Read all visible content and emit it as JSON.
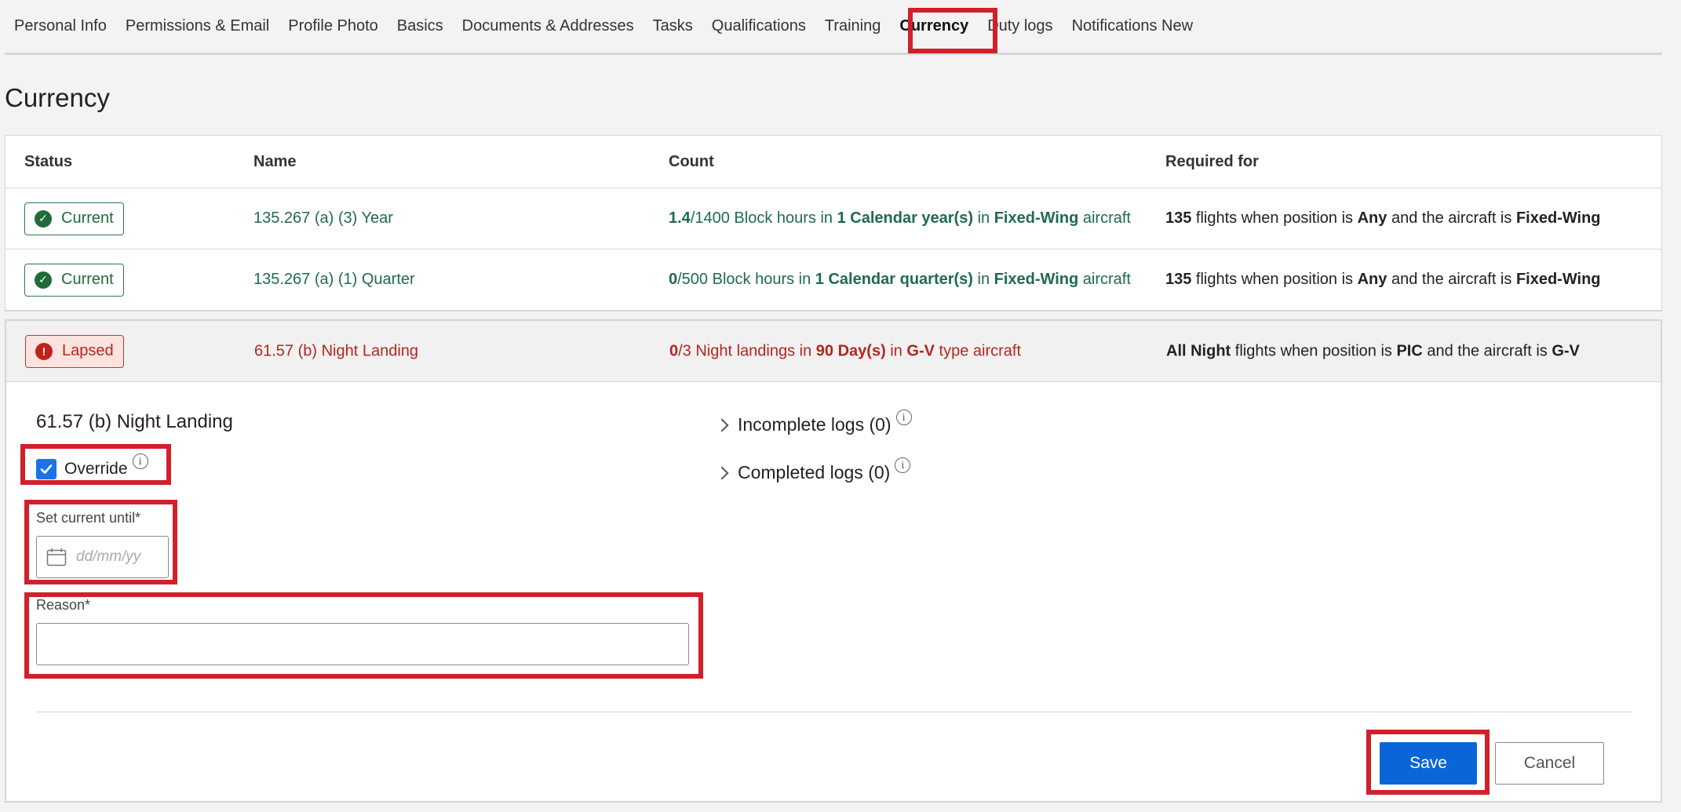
{
  "tabs": [
    {
      "label": "Personal Info"
    },
    {
      "label": "Permissions & Email"
    },
    {
      "label": "Profile Photo"
    },
    {
      "label": "Basics"
    },
    {
      "label": "Documents & Addresses"
    },
    {
      "label": "Tasks"
    },
    {
      "label": "Qualifications"
    },
    {
      "label": "Training"
    },
    {
      "label": "Currency",
      "active": true
    },
    {
      "label": "Duty logs"
    },
    {
      "label": "Notifications New"
    }
  ],
  "page_title": "Currency",
  "table": {
    "headers": {
      "status": "Status",
      "name": "Name",
      "count": "Count",
      "required_for": "Required for"
    },
    "rows": [
      {
        "status": "Current",
        "name": "135.267 (a) (3) Year",
        "count": {
          "current": "1.4",
          "rest": "/1400 Block hours in ",
          "period": "1 Calendar year(s)",
          "in": " in ",
          "type": "Fixed-Wing",
          "suffix": " aircraft"
        },
        "required": {
          "flights": "135",
          "t1": " flights when position is ",
          "position": "Any",
          "t2": " and the aircraft is ",
          "aircraft": "Fixed-Wing"
        }
      },
      {
        "status": "Current",
        "name": "135.267 (a) (1) Quarter",
        "count": {
          "current": "0",
          "rest": "/500 Block hours in ",
          "period": "1 Calendar quarter(s)",
          "in": " in ",
          "type": "Fixed-Wing",
          "suffix": " aircraft"
        },
        "required": {
          "flights": "135",
          "t1": " flights when position is ",
          "position": "Any",
          "t2": " and the aircraft is ",
          "aircraft": "Fixed-Wing"
        }
      },
      {
        "status": "Lapsed",
        "name": "61.57 (b) Night Landing",
        "count": {
          "current": "0",
          "rest": "/3 Night landings in ",
          "period": "90 Day(s)",
          "in": " in ",
          "type": "G-V",
          "suffix": " type aircraft"
        },
        "required": {
          "flights": "All Night",
          "t1": " flights when position is ",
          "position": "PIC",
          "t2": " and the aircraft is ",
          "aircraft": "G-V"
        }
      }
    ]
  },
  "detail": {
    "title": "61.57 (b) Night Landing",
    "override_label": "Override",
    "override_checked": true,
    "set_current_label": "Set current until*",
    "date_placeholder": "dd/mm/yy",
    "reason_label": "Reason*",
    "reason_value": "",
    "incomplete_logs": "Incomplete logs (0)",
    "completed_logs": "Completed logs (0)",
    "save_label": "Save",
    "cancel_label": "Cancel"
  },
  "colors": {
    "highlight": "#d0202a",
    "current": "#1f6b4a",
    "lapsed": "#b3261e",
    "primary": "#0a66d8"
  }
}
